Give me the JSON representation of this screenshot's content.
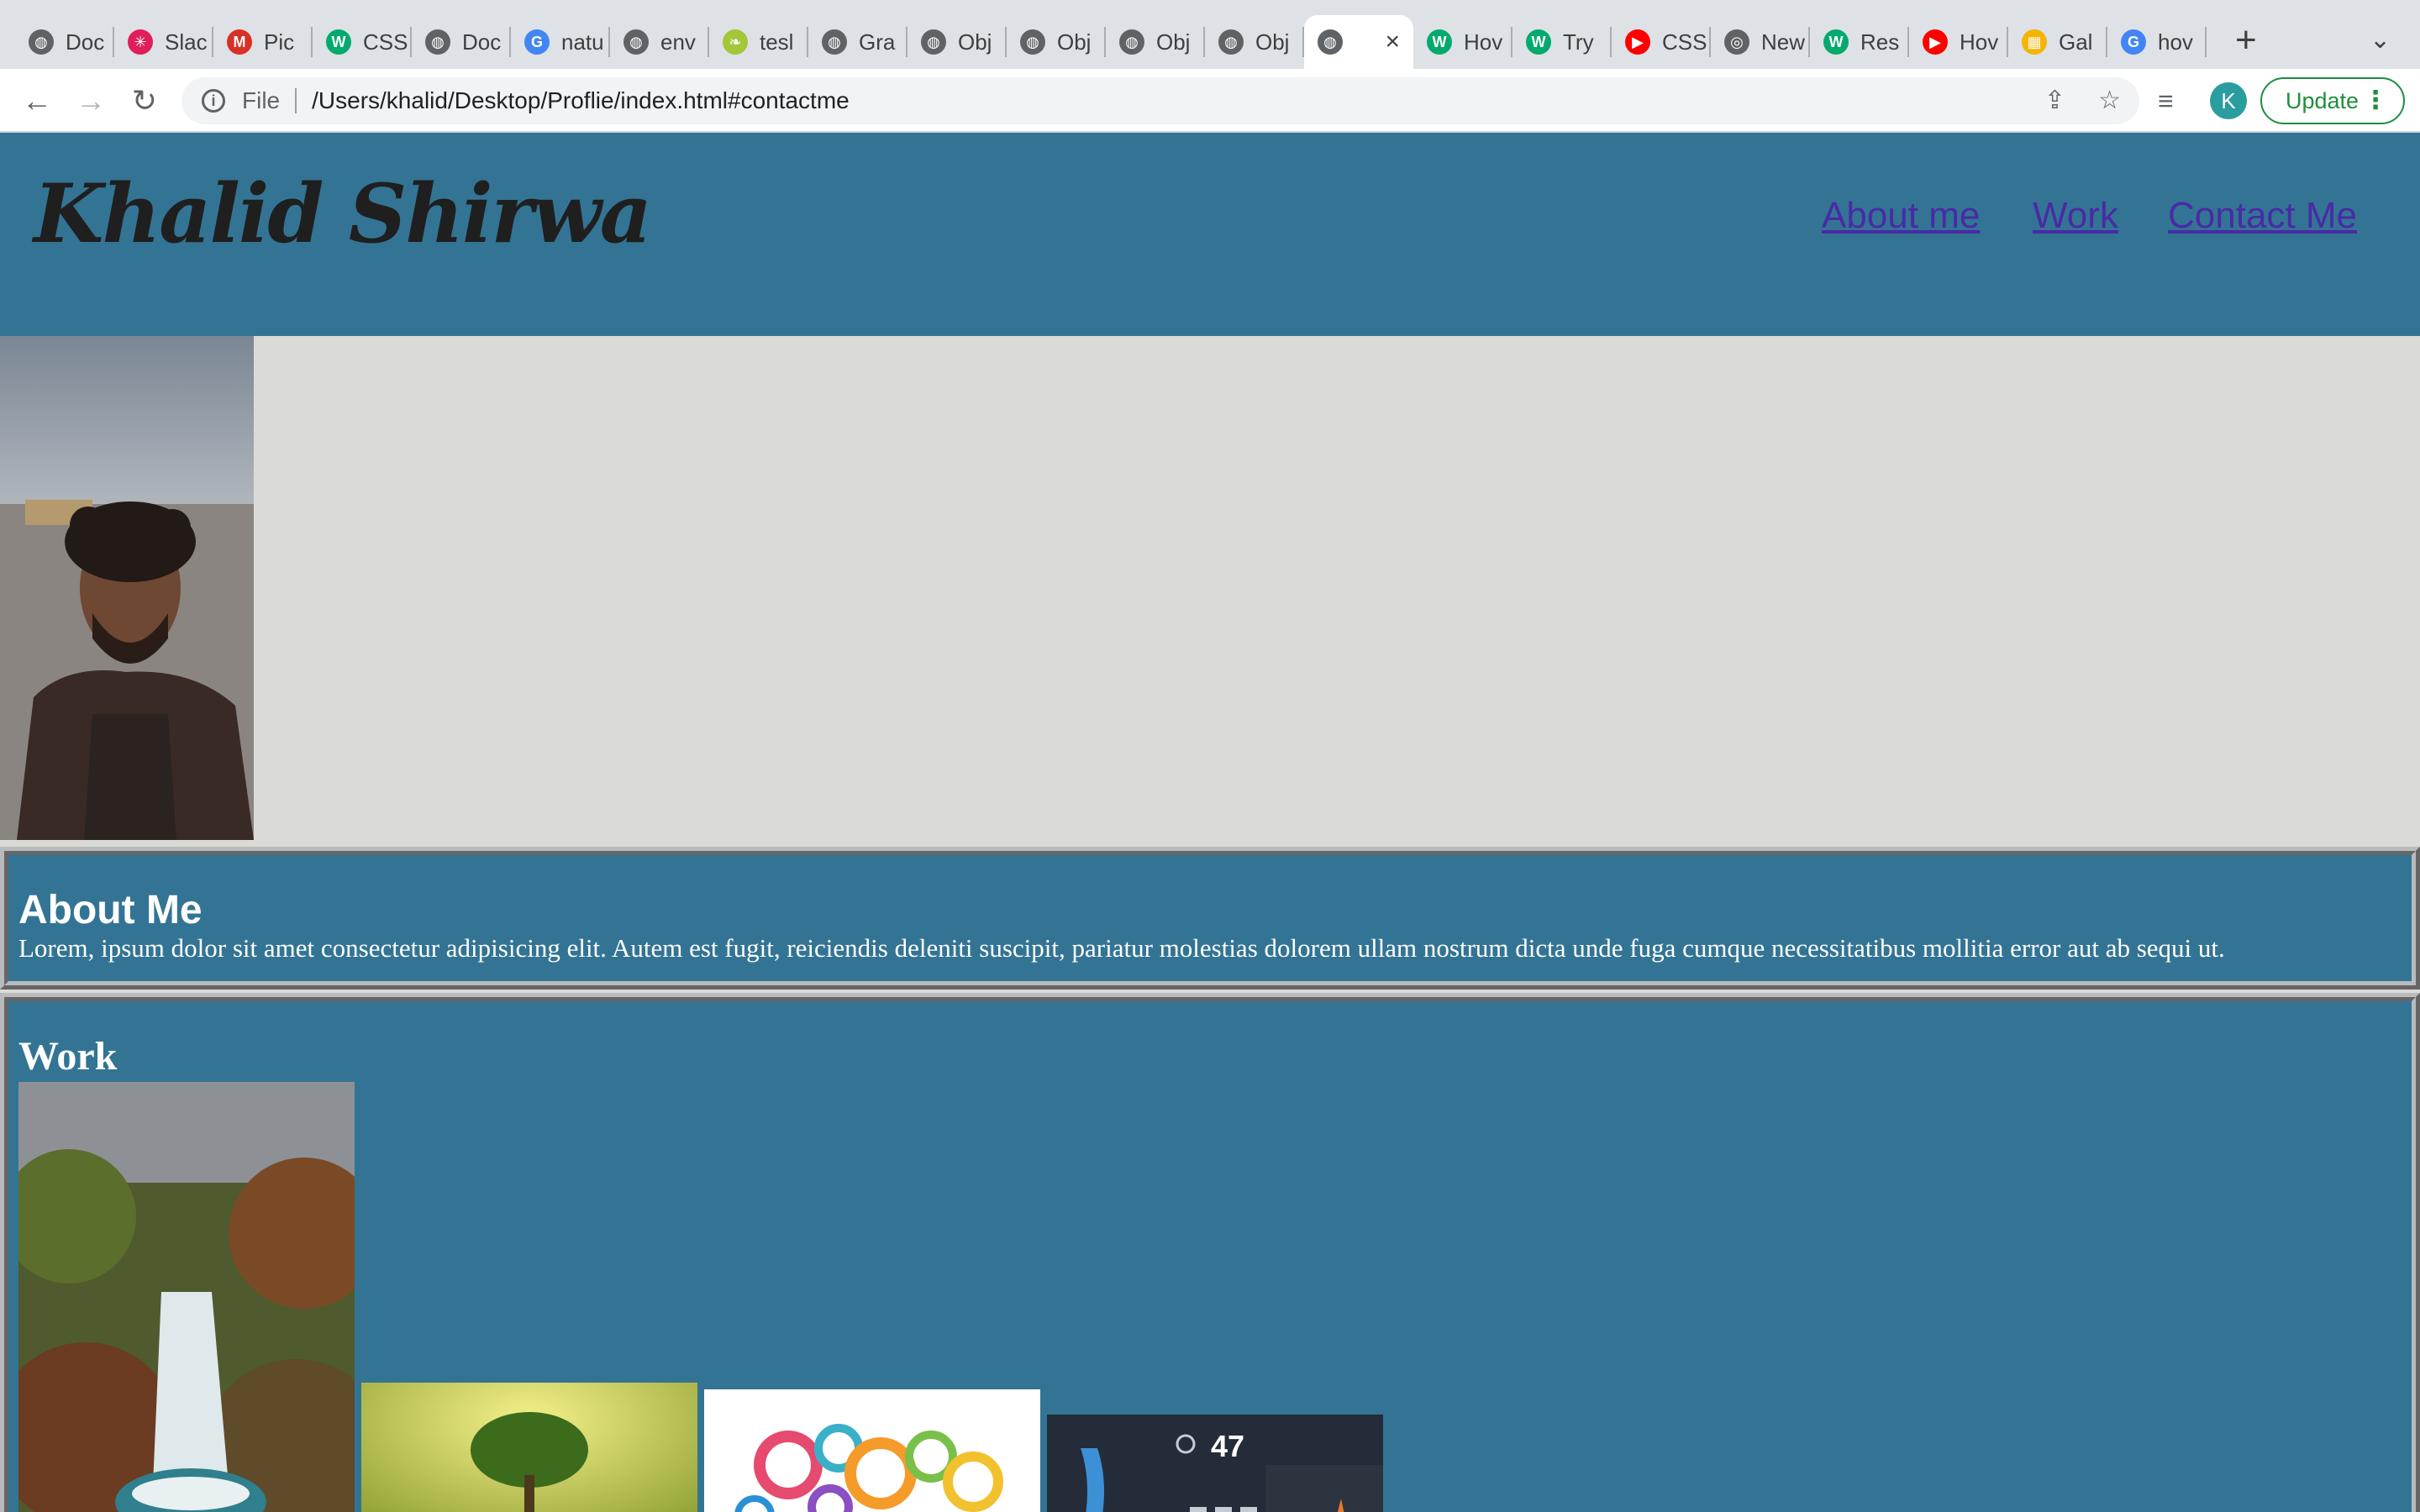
{
  "browser": {
    "tabs": [
      {
        "label": "Doc",
        "icon": "globe-icon",
        "color": "#5f6368"
      },
      {
        "label": "Slac",
        "icon": "slack-icon",
        "color": "#e01e5a"
      },
      {
        "label": "Pic",
        "icon": "gmail-icon",
        "color": "#d93025"
      },
      {
        "label": "CSS",
        "icon": "w3schools-icon",
        "color": "#04aa6d"
      },
      {
        "label": "Doc",
        "icon": "globe-icon",
        "color": "#5f6368"
      },
      {
        "label": "natu",
        "icon": "google-icon",
        "color": "#4285f4"
      },
      {
        "label": "env",
        "icon": "globe-icon",
        "color": "#5f6368"
      },
      {
        "label": "tesl",
        "icon": "leaf-icon",
        "color": "#a4c639"
      },
      {
        "label": "Gra",
        "icon": "globe-icon",
        "color": "#5f6368"
      },
      {
        "label": "Obj",
        "icon": "globe-icon",
        "color": "#5f6368"
      },
      {
        "label": "Obj",
        "icon": "globe-icon",
        "color": "#5f6368"
      },
      {
        "label": "Obj",
        "icon": "globe-icon",
        "color": "#5f6368"
      },
      {
        "label": "Obj",
        "icon": "globe-icon",
        "color": "#5f6368"
      },
      {
        "label": "",
        "icon": "globe-icon",
        "color": "#5f6368",
        "active": true
      },
      {
        "label": "Hov",
        "icon": "w3schools-icon",
        "color": "#04aa6d"
      },
      {
        "label": "Try",
        "icon": "w3schools-icon",
        "color": "#04aa6d"
      },
      {
        "label": "CSS",
        "icon": "youtube-icon",
        "color": "#ff0000"
      },
      {
        "label": "New",
        "icon": "chrome-icon",
        "color": "#5f6368"
      },
      {
        "label": "Res",
        "icon": "w3schools-icon",
        "color": "#04aa6d"
      },
      {
        "label": "Hov",
        "icon": "youtube-icon",
        "color": "#ff0000"
      },
      {
        "label": "Gal",
        "icon": "gallery-icon",
        "color": "#f4b400"
      },
      {
        "label": "hov",
        "icon": "google-icon",
        "color": "#4285f4"
      }
    ],
    "scheme": "File",
    "url": "/Users/khalid/Desktop/Proflie/index.html#contactme",
    "profile_initial": "K",
    "update_label": "Update"
  },
  "site": {
    "title": "Khalid Shirwa",
    "nav": [
      {
        "label": "About me"
      },
      {
        "label": "Work"
      },
      {
        "label": "Contact Me"
      }
    ],
    "about": {
      "heading": "About Me",
      "body": "Lorem, ipsum dolor sit amet consectetur adipisicing elit. Autem est fugit, reiciendis deleniti suscipit, pariatur molestias dolorem ullam nostrum dicta unde fuga cumque necessitatibus mollitia error aut ab sequi ut."
    },
    "work": {
      "heading": "Work",
      "images": [
        {
          "subject": "waterfall-photo"
        },
        {
          "subject": "tree-photo"
        },
        {
          "subject": "gears-illustration"
        },
        {
          "subject": "car-dashboard-screen",
          "speed": "47"
        }
      ]
    }
  },
  "colors": {
    "header_bg": "#337494",
    "page_bg": "#dadbd6",
    "link": "#4a2aa6"
  }
}
